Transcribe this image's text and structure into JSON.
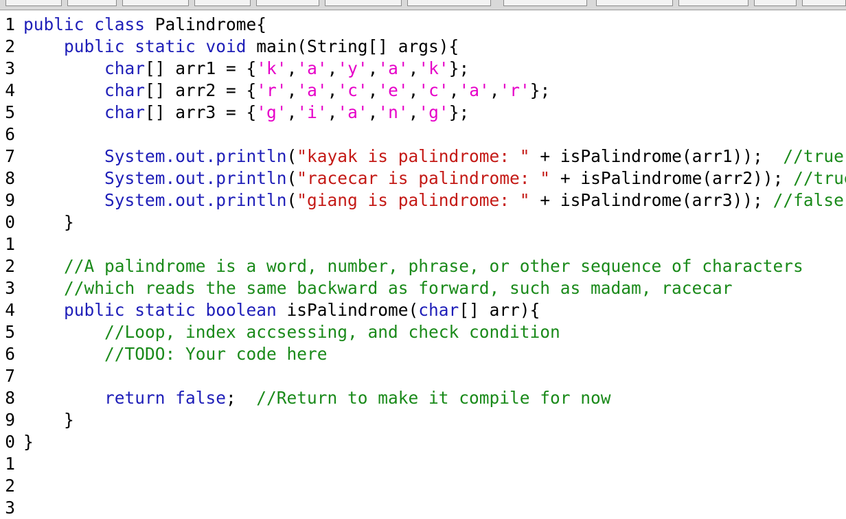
{
  "editor": {
    "lines": [
      {
        "num": "1",
        "tokens": [
          [
            "kw",
            "public class "
          ],
          [
            "plain",
            "Palindrome{"
          ]
        ]
      },
      {
        "num": "2",
        "tokens": [
          [
            "plain",
            "    "
          ],
          [
            "kw",
            "public static void "
          ],
          [
            "plain",
            "main(String[] args){"
          ]
        ]
      },
      {
        "num": "3",
        "tokens": [
          [
            "plain",
            "        "
          ],
          [
            "kw",
            "char"
          ],
          [
            "plain",
            "[] arr1 = {"
          ],
          [
            "chr",
            "'k'"
          ],
          [
            "plain",
            ","
          ],
          [
            "chr",
            "'a'"
          ],
          [
            "plain",
            ","
          ],
          [
            "chr",
            "'y'"
          ],
          [
            "plain",
            ","
          ],
          [
            "chr",
            "'a'"
          ],
          [
            "plain",
            ","
          ],
          [
            "chr",
            "'k'"
          ],
          [
            "plain",
            "};"
          ]
        ]
      },
      {
        "num": "4",
        "tokens": [
          [
            "plain",
            "        "
          ],
          [
            "kw",
            "char"
          ],
          [
            "plain",
            "[] arr2 = {"
          ],
          [
            "chr",
            "'r'"
          ],
          [
            "plain",
            ","
          ],
          [
            "chr",
            "'a'"
          ],
          [
            "plain",
            ","
          ],
          [
            "chr",
            "'c'"
          ],
          [
            "plain",
            ","
          ],
          [
            "chr",
            "'e'"
          ],
          [
            "plain",
            ","
          ],
          [
            "chr",
            "'c'"
          ],
          [
            "plain",
            ","
          ],
          [
            "chr",
            "'a'"
          ],
          [
            "plain",
            ","
          ],
          [
            "chr",
            "'r'"
          ],
          [
            "plain",
            "};"
          ]
        ]
      },
      {
        "num": "5",
        "tokens": [
          [
            "plain",
            "        "
          ],
          [
            "kw",
            "char"
          ],
          [
            "plain",
            "[] arr3 = {"
          ],
          [
            "chr",
            "'g'"
          ],
          [
            "plain",
            ","
          ],
          [
            "chr",
            "'i'"
          ],
          [
            "plain",
            ","
          ],
          [
            "chr",
            "'a'"
          ],
          [
            "plain",
            ","
          ],
          [
            "chr",
            "'n'"
          ],
          [
            "plain",
            ","
          ],
          [
            "chr",
            "'g'"
          ],
          [
            "plain",
            "};"
          ]
        ]
      },
      {
        "num": "6",
        "tokens": []
      },
      {
        "num": "7",
        "tokens": [
          [
            "plain",
            "        "
          ],
          [
            "fld",
            "System.out.println"
          ],
          [
            "plain",
            "("
          ],
          [
            "str",
            "\"kayak is palindrome: \""
          ],
          [
            "plain",
            " + isPalindrome(arr1));  "
          ],
          [
            "cmt",
            "//true"
          ]
        ]
      },
      {
        "num": "8",
        "tokens": [
          [
            "plain",
            "        "
          ],
          [
            "fld",
            "System.out.println"
          ],
          [
            "plain",
            "("
          ],
          [
            "str",
            "\"racecar is palindrome: \""
          ],
          [
            "plain",
            " + isPalindrome(arr2)); "
          ],
          [
            "cmt",
            "//true"
          ]
        ]
      },
      {
        "num": "9",
        "tokens": [
          [
            "plain",
            "        "
          ],
          [
            "fld",
            "System.out.println"
          ],
          [
            "plain",
            "("
          ],
          [
            "str",
            "\"giang is palindrome: \""
          ],
          [
            "plain",
            " + isPalindrome(arr3)); "
          ],
          [
            "cmt",
            "//false"
          ]
        ]
      },
      {
        "num": "0",
        "tokens": [
          [
            "plain",
            "    }"
          ]
        ]
      },
      {
        "num": "1",
        "tokens": []
      },
      {
        "num": "2",
        "tokens": [
          [
            "plain",
            "    "
          ],
          [
            "cmt",
            "//A palindrome is a word, number, phrase, or other sequence of characters"
          ]
        ]
      },
      {
        "num": "3",
        "tokens": [
          [
            "plain",
            "    "
          ],
          [
            "cmt",
            "//which reads the same backward as forward, such as madam, racecar"
          ]
        ]
      },
      {
        "num": "4",
        "tokens": [
          [
            "plain",
            "    "
          ],
          [
            "kw",
            "public static boolean "
          ],
          [
            "plain",
            "isPalindrome("
          ],
          [
            "kw",
            "char"
          ],
          [
            "plain",
            "[] arr){"
          ]
        ]
      },
      {
        "num": "5",
        "tokens": [
          [
            "plain",
            "        "
          ],
          [
            "cmt",
            "//Loop, index accsessing, and check condition"
          ]
        ]
      },
      {
        "num": "6",
        "tokens": [
          [
            "plain",
            "        "
          ],
          [
            "cmt",
            "//TODO: Your code here"
          ]
        ]
      },
      {
        "num": "7",
        "tokens": []
      },
      {
        "num": "8",
        "tokens": [
          [
            "plain",
            "        "
          ],
          [
            "kw",
            "return false"
          ],
          [
            "plain",
            ";  "
          ],
          [
            "cmt",
            "//Return to make it compile for now"
          ]
        ]
      },
      {
        "num": "9",
        "tokens": [
          [
            "plain",
            "    }"
          ]
        ]
      },
      {
        "num": "0",
        "tokens": [
          [
            "plain",
            "}"
          ]
        ]
      },
      {
        "num": "1",
        "tokens": []
      },
      {
        "num": "2",
        "tokens": []
      },
      {
        "num": "3",
        "tokens": []
      }
    ]
  },
  "colors": {
    "keyword": "#1e1eb8",
    "string": "#c41a16",
    "char_literal": "#e600c8",
    "comment": "#1a8a1a"
  }
}
